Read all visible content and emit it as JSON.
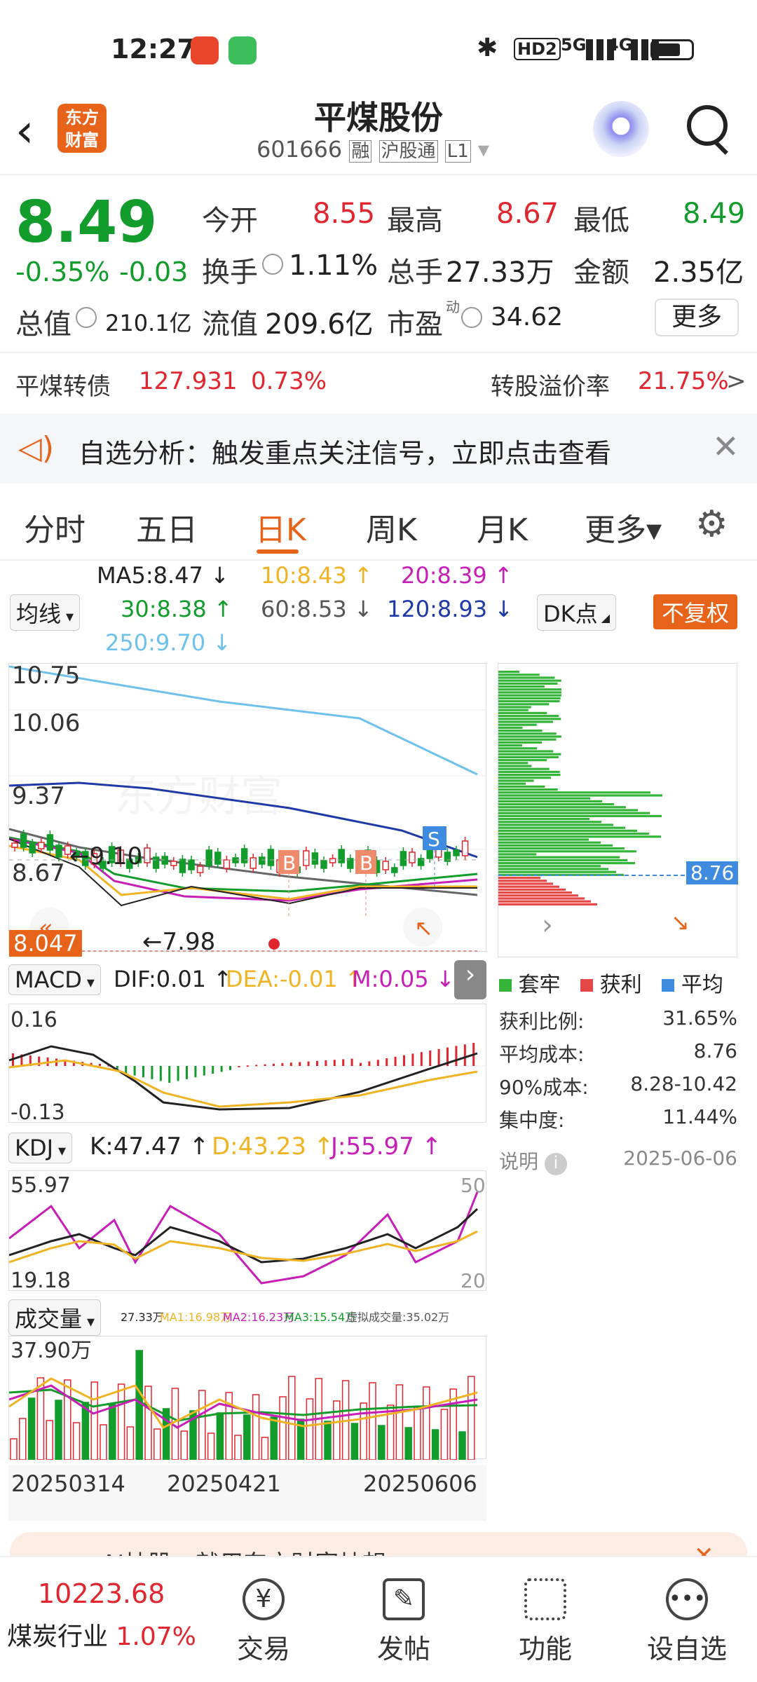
{
  "status_bar": {
    "time": "12:27",
    "app_badge_1": "点外卖",
    "signal_1": "5G",
    "signal_2": "4G",
    "hd": "HD2"
  },
  "nav": {
    "logo": "东方财富",
    "title": "平煤股份",
    "code": "601666",
    "tag_rong": "融",
    "tag_hgt": "沪股通",
    "tag_l1": "L1"
  },
  "quote": {
    "price": "8.49",
    "change_pct": "-0.35%",
    "change": "-0.03",
    "open_label": "今开",
    "open": "8.55",
    "high_label": "最高",
    "high": "8.67",
    "low_label": "最低",
    "low": "8.49",
    "turnover_label": "换手",
    "turnover": "1.11%",
    "vol_label": "总手",
    "vol": "27.33万",
    "amount_label": "金额",
    "amount": "2.35亿",
    "mcap_label": "总值",
    "mcap": "210.1亿",
    "float_label": "流值",
    "float": "209.6亿",
    "pe_label": "市盈",
    "pe_sup": "动",
    "pe": "34.62",
    "more": "更多"
  },
  "bond": {
    "name": "平煤转债",
    "price": "127.931",
    "pct": "0.73%",
    "premium_label": "转股溢价率",
    "premium": "21.75%",
    "arrow": ">"
  },
  "banner": {
    "text": "自选分析：触发重点关注信号，立即点击查看"
  },
  "tabs": [
    "分时",
    "五日",
    "日K",
    "周K",
    "月K",
    "更多▾"
  ],
  "ma": {
    "ma5": "MA5:8.47 ↓",
    "ma10": "10:8.43 ↑",
    "ma20": "20:8.39 ↑",
    "ma30": "30:8.38 ↑",
    "ma60": "60:8.53 ↓",
    "ma120": "120:8.93 ↓",
    "ma250": "250:9.70 ↓",
    "avg_dd": "均线",
    "dk": "DK点",
    "fq": "不复权"
  },
  "kline": {
    "y_labels": [
      "10.75",
      "10.06",
      "9.37",
      "8.67"
    ],
    "current": "8.047",
    "hi_label": "9.10",
    "lo_label": "7.98",
    "b": "B",
    "s": "S",
    "watermark": "东方财富"
  },
  "chip": {
    "avg_badge": "8.76",
    "legend": [
      "套牢",
      "获利",
      "平均"
    ],
    "rows": [
      [
        "获利比例:",
        "31.65%"
      ],
      [
        "平均成本:",
        "8.76"
      ],
      [
        "90%成本:",
        "8.28-10.42"
      ],
      [
        "集中度:",
        "11.44%"
      ]
    ],
    "note": "说明",
    "date": "2025-06-06"
  },
  "macd": {
    "name": "MACD",
    "dif": "DIF:0.01 ↑",
    "dea": "DEA:-0.01 ↑",
    "m": "M:0.05 ↓",
    "top": "0.16",
    "bottom": "-0.13"
  },
  "kdj": {
    "name": "KDJ",
    "k": "K:47.47 ↑",
    "d": "D:43.23 ↑",
    "j": "J:55.97 ↑",
    "top": "55.97",
    "bottom": "19.18",
    "r_top": "50",
    "r_bottom": "20"
  },
  "volume": {
    "name": "成交量",
    "v": "27.33万",
    "ma1": "MA1:16.98万",
    "ma2": "MA2:16.23万",
    "ma3": "MA3:15.54万",
    "virtual": "虚拟成交量:35.02万",
    "top": "37.90万",
    "dates": [
      "20250314",
      "20250421",
      "20250606"
    ]
  },
  "ai": {
    "text": "AI炒股，就用东方财富炒想"
  },
  "bottom": {
    "index": "10223.68",
    "industry": "煤炭行业",
    "industry_pct": "1.07%",
    "items": [
      "交易",
      "发帖",
      "功能",
      "设自选"
    ]
  },
  "colors": {
    "red": "#e0262f",
    "green": "#129c2b",
    "orange": "#e8631a",
    "blue": "#1f3aa6"
  }
}
